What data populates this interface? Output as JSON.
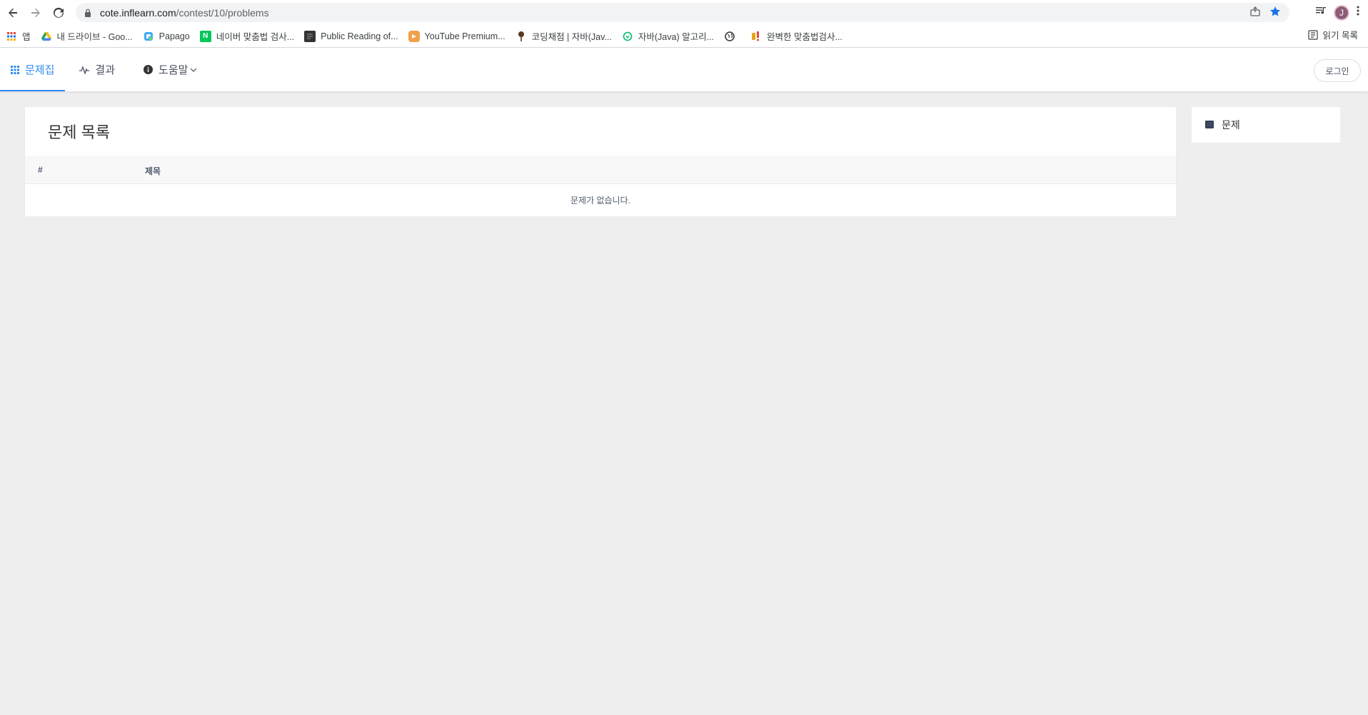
{
  "browser": {
    "url_host": "cote.inflearn.com",
    "url_path": "/contest/10/problems",
    "avatar_letter": "J",
    "reading_list": "읽기 목록"
  },
  "bookmarks": [
    {
      "label": "앱",
      "icon": "apps-grid-icon",
      "color": "#e8453c"
    },
    {
      "label": "내 드라이브 - Goo...",
      "icon": "google-drive-icon",
      "color": "#1fa463"
    },
    {
      "label": "Papago",
      "icon": "papago-icon",
      "color": "#3fa9f5"
    },
    {
      "label": "네이버 맞춤법 검사...",
      "icon": "naver-icon",
      "color": "#03c75a"
    },
    {
      "label": "Public Reading of...",
      "icon": "document-icon",
      "color": "#333333"
    },
    {
      "label": "YouTube Premium...",
      "icon": "youtube-icon",
      "color": "#f0a04b"
    },
    {
      "label": "코딩채점 | 자바(Jav...",
      "icon": "pin-icon",
      "color": "#5a3a1a"
    },
    {
      "label": "자바(Java) 알고리...",
      "icon": "inflearn-icon",
      "color": "#1dc078"
    },
    {
      "label": "",
      "icon": "globe-icon",
      "color": "#333333"
    },
    {
      "label": "완벽한 맞춤법검사...",
      "icon": "spellcheck-icon",
      "color": "#e8a317"
    }
  ],
  "header": {
    "menu": [
      {
        "label": "문제집",
        "icon": "grid-icon",
        "active": true
      },
      {
        "label": "결과",
        "icon": "pulse-icon",
        "active": false
      },
      {
        "label": "도움말",
        "icon": "info-icon",
        "active": false
      }
    ],
    "login_label": "로그인"
  },
  "main": {
    "title": "문제 목록",
    "columns": [
      "#",
      "제목"
    ],
    "empty_text": "문제가 없습니다."
  },
  "side": {
    "label": "문제"
  },
  "colors": {
    "accent": "#2d8cf0",
    "page_bg": "#eeeeee"
  }
}
